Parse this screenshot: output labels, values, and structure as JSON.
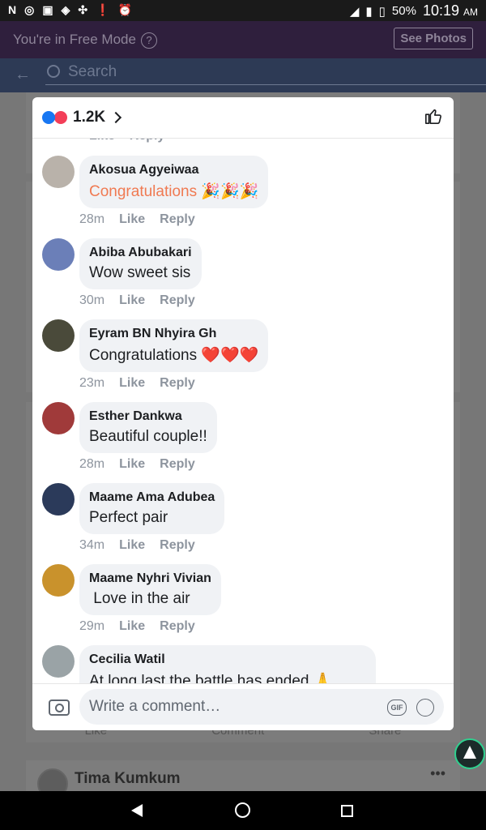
{
  "status_bar": {
    "battery": "50%",
    "time": "10:19",
    "ampm": "AM"
  },
  "background": {
    "free_mode_text": "You're in Free Mode",
    "see_photos": "See Photos",
    "search_placeholder": "Search",
    "actions": [
      "Like",
      "Comment",
      "Share"
    ],
    "next_post_author": "Tima Kumkum"
  },
  "modal": {
    "reaction_count": "1.2K",
    "comments": [
      {
        "author": "Akosua Agyeiwaa",
        "text": "Congratulations 🎉🎉🎉",
        "time": "28m",
        "style": "orange",
        "avatar_color": "#b9b2aa"
      },
      {
        "author": "Abiba Abubakari",
        "text": "Wow sweet sis",
        "time": "30m",
        "style": "",
        "avatar_color": "#6b7fb8"
      },
      {
        "author": "Eyram BN Nhyira Gh",
        "text": "Congratulations ❤️❤️❤️",
        "time": "23m",
        "style": "",
        "avatar_color": "#4a4a3a"
      },
      {
        "author": "Esther Dankwa",
        "text": "Beautiful couple!!",
        "time": "28m",
        "style": "",
        "avatar_color": "#a03a3a"
      },
      {
        "author": "Maame Ama Adubea",
        "text": "Perfect pair",
        "time": "34m",
        "style": "",
        "avatar_color": "#2b3a5a"
      },
      {
        "author": "Maame Nyhri Vivian",
        "text": " Love in the air",
        "time": "29m",
        "style": "",
        "avatar_color": "#c9922c"
      },
      {
        "author": "Cecilia Watil",
        "text": "At long last the battle has ended 🙏",
        "time": "",
        "style": "",
        "avatar_color": "#9aa3a6"
      }
    ],
    "like_label": "Like",
    "reply_label": "Reply",
    "composer_placeholder": "Write a comment…",
    "gif_label": "GIF"
  }
}
